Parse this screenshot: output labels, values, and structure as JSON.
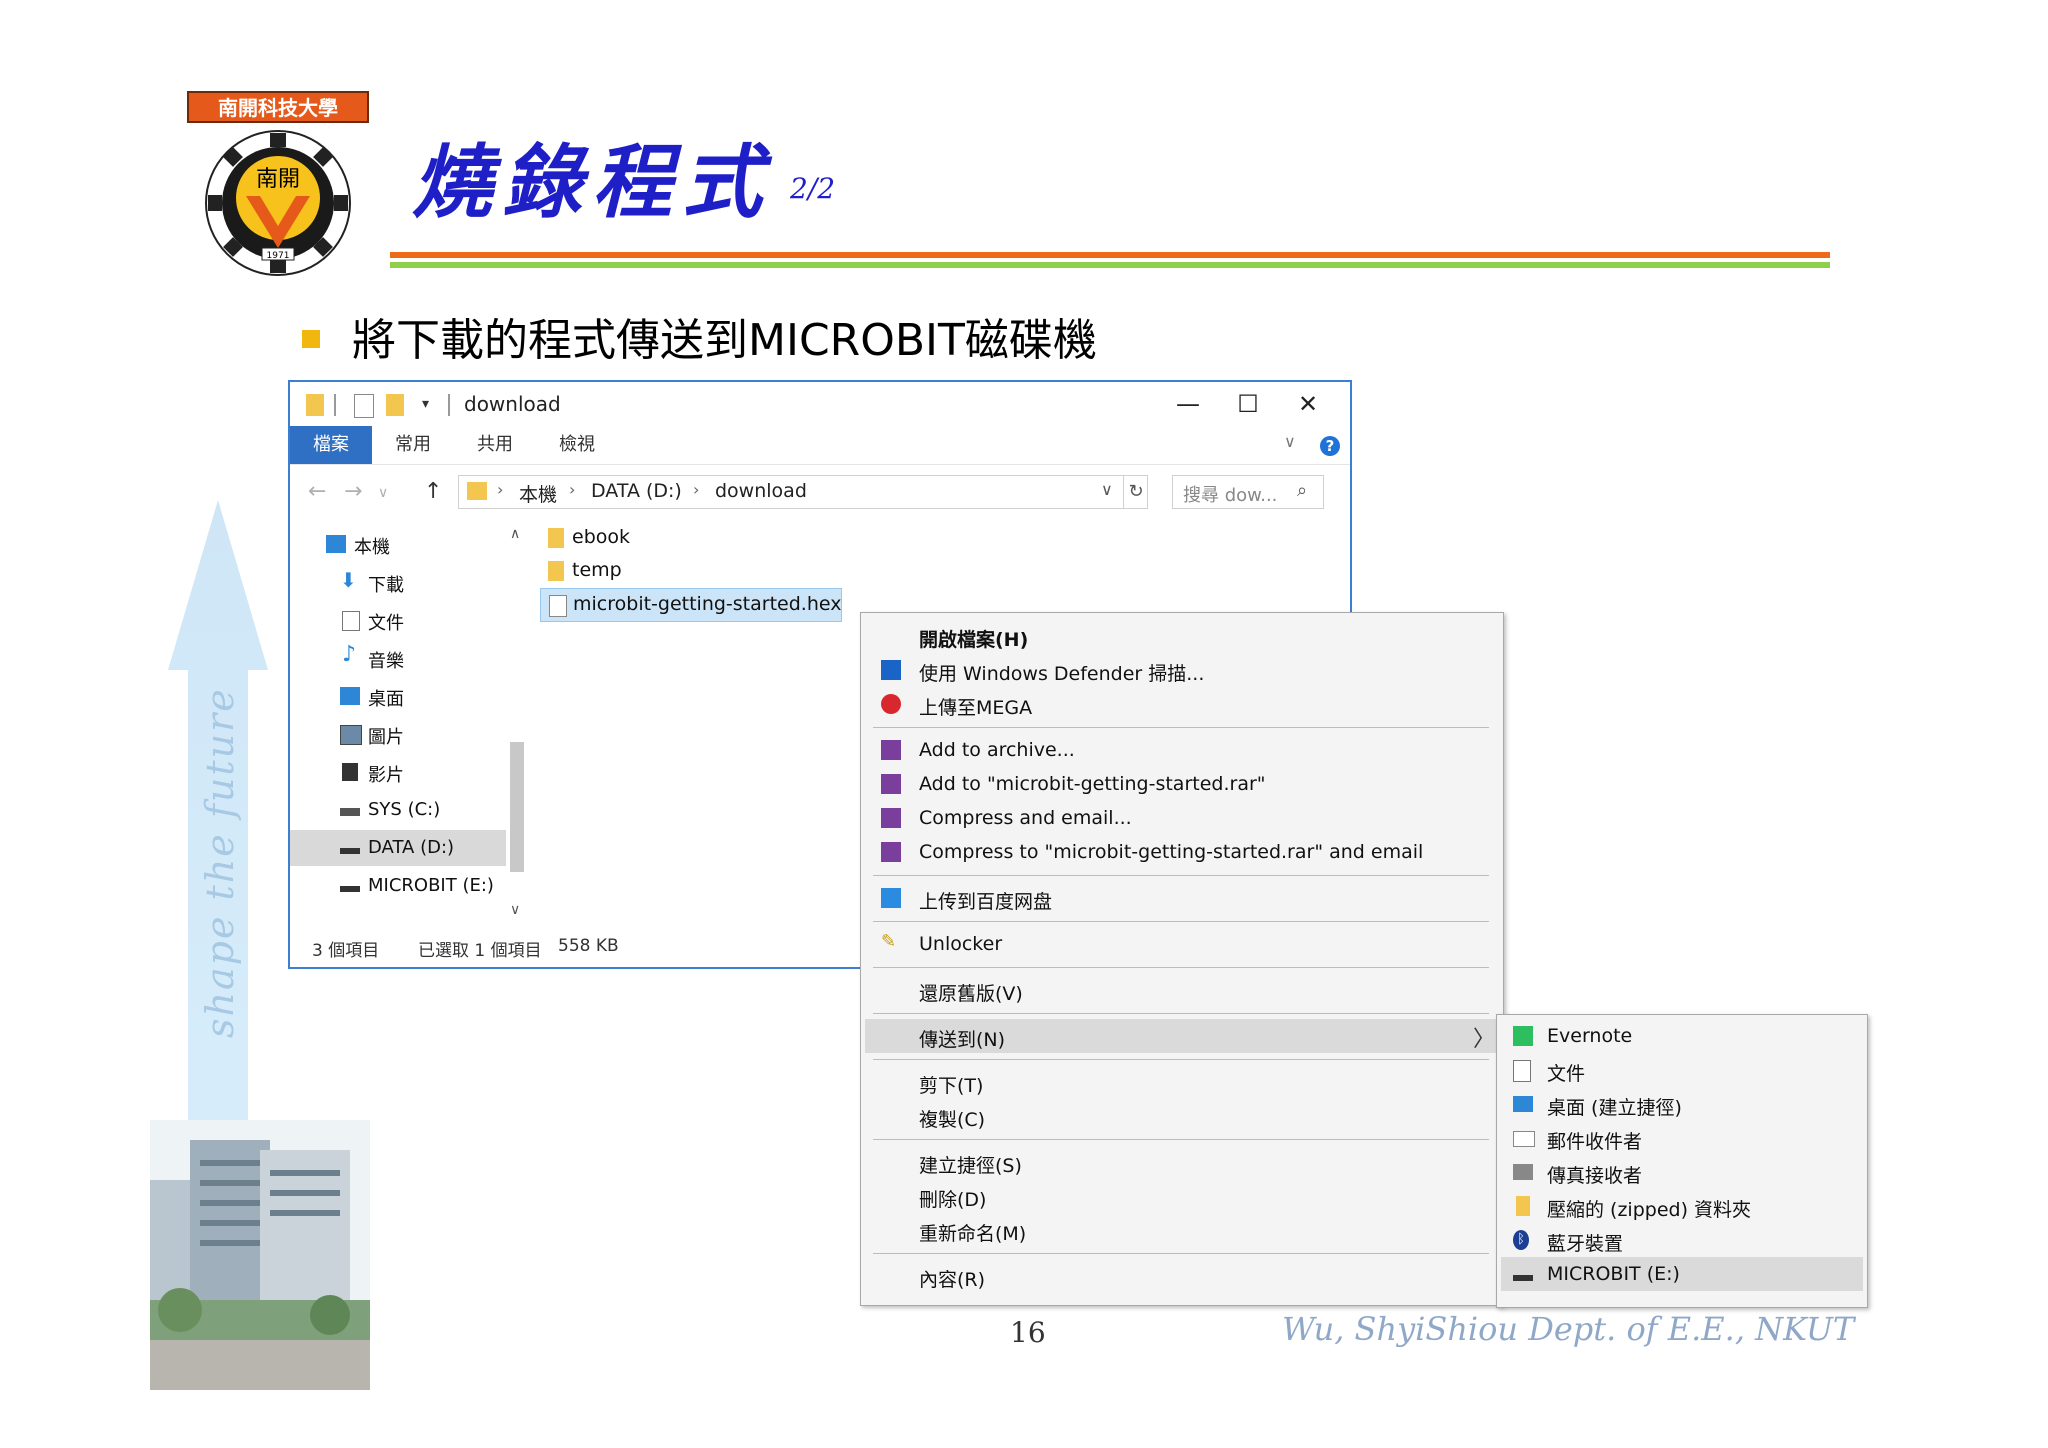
{
  "slide": {
    "title": "燒錄程式",
    "page_fraction": "2/2",
    "bullet": "將下載的程式傳送到MICROBIT磁碟機",
    "motto": "shape the future",
    "page_number": "16",
    "footer": "Wu, ShyiShiou  Dept. of E.E., NKUT",
    "logo_text": "南開科技大學",
    "logo_center": "南開",
    "logo_year": "1971",
    "logo_ring": "NAN KAI UNIVERSITY OF TECHNOLOGY"
  },
  "colors": {
    "title": "#1f1fc8",
    "rule_orange": "#ee6a18",
    "rule_green": "#8ed04a",
    "bullet": "#f2b70f",
    "window_accent": "#2f6fc4",
    "selection": "#cce4f7"
  },
  "explorer": {
    "title": "download",
    "window_buttons": {
      "minimize": "—",
      "maximize": "☐",
      "close": "✕"
    },
    "ribbon_tabs": [
      "檔案",
      "常用",
      "共用",
      "檢視"
    ],
    "address": {
      "crumbs": [
        "本機",
        "DATA (D:)",
        "download"
      ],
      "search_placeholder": "搜尋 dow..."
    },
    "nav_items": [
      {
        "label": "本機",
        "icon": "computer-icon"
      },
      {
        "label": "下載",
        "icon": "download-icon"
      },
      {
        "label": "文件",
        "icon": "document-icon"
      },
      {
        "label": "音樂",
        "icon": "music-icon"
      },
      {
        "label": "桌面",
        "icon": "desktop-icon"
      },
      {
        "label": "圖片",
        "icon": "pictures-icon"
      },
      {
        "label": "影片",
        "icon": "videos-icon"
      },
      {
        "label": "SYS (C:)",
        "icon": "drive-icon"
      },
      {
        "label": "DATA (D:)",
        "icon": "drive-icon"
      },
      {
        "label": "MICROBIT (E:)",
        "icon": "drive-icon"
      }
    ],
    "files": [
      {
        "name": "ebook",
        "type": "folder"
      },
      {
        "name": "temp",
        "type": "folder"
      },
      {
        "name": "microbit-getting-started.hex",
        "type": "file"
      }
    ],
    "status": {
      "count": "3 個項目",
      "selected": "已選取 1 個項目",
      "size": "558 KB"
    }
  },
  "context_menu": {
    "items": [
      {
        "label": "開啟檔案(H)",
        "icon": ""
      },
      {
        "label": "使用 Windows Defender 掃描...",
        "icon": "defender-icon"
      },
      {
        "label": "上傳至MEGA",
        "icon": "mega-icon"
      },
      {
        "label": "Add to archive...",
        "icon": "winrar-icon"
      },
      {
        "label": "Add to \"microbit-getting-started.rar\"",
        "icon": "winrar-icon"
      },
      {
        "label": "Compress and email...",
        "icon": "winrar-icon"
      },
      {
        "label": "Compress to \"microbit-getting-started.rar\" and email",
        "icon": "winrar-icon"
      },
      {
        "label": "上传到百度网盘",
        "icon": "baidu-icon"
      },
      {
        "label": "Unlocker",
        "icon": "unlocker-icon"
      },
      {
        "label": "還原舊版(V)",
        "icon": ""
      },
      {
        "label": "傳送到(N)",
        "icon": ""
      },
      {
        "label": "剪下(T)",
        "icon": ""
      },
      {
        "label": "複製(C)",
        "icon": ""
      },
      {
        "label": "建立捷徑(S)",
        "icon": ""
      },
      {
        "label": "刪除(D)",
        "icon": ""
      },
      {
        "label": "重新命名(M)",
        "icon": ""
      },
      {
        "label": "內容(R)",
        "icon": ""
      }
    ],
    "submenu_arrow": "〉"
  },
  "send_to_menu": {
    "items": [
      {
        "label": "Evernote",
        "icon": "evernote-icon"
      },
      {
        "label": "文件",
        "icon": "document-icon"
      },
      {
        "label": "桌面 (建立捷徑)",
        "icon": "desktop-icon"
      },
      {
        "label": "郵件收件者",
        "icon": "mail-icon"
      },
      {
        "label": "傳真接收者",
        "icon": "fax-icon"
      },
      {
        "label": "壓縮的 (zipped) 資料夾",
        "icon": "zip-folder-icon"
      },
      {
        "label": "藍牙裝置",
        "icon": "bluetooth-icon"
      },
      {
        "label": "MICROBIT (E:)",
        "icon": "drive-icon"
      }
    ]
  }
}
